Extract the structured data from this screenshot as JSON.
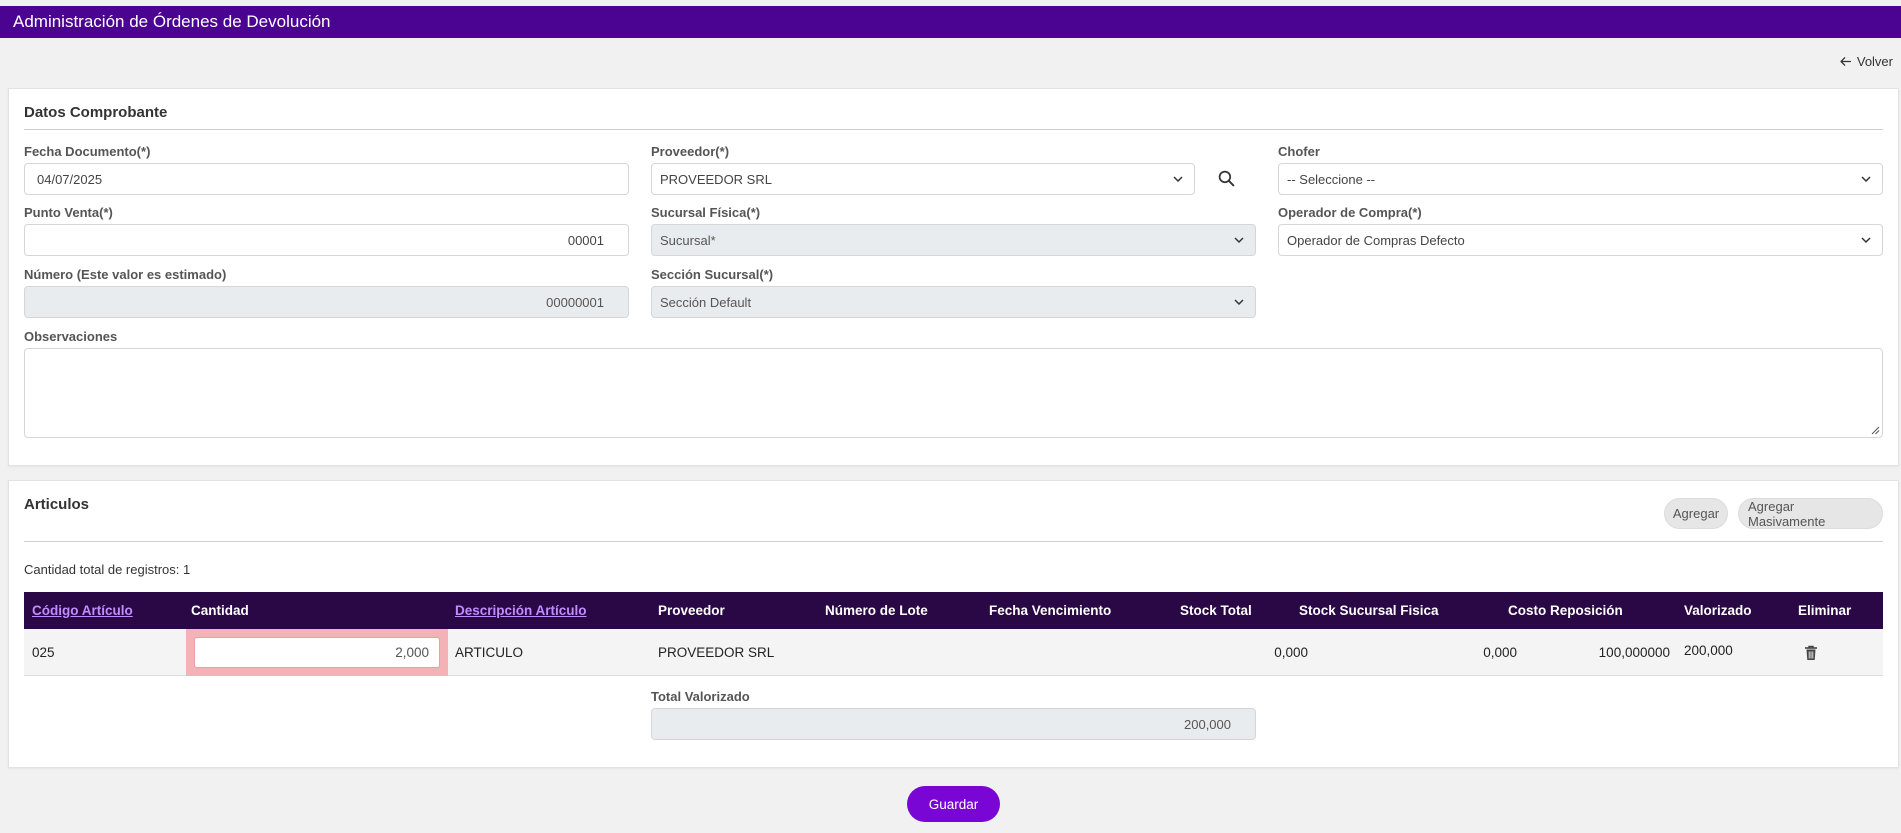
{
  "app": {
    "title": "Administración de Órdenes de Devolución",
    "back_label": "Volver"
  },
  "voucher": {
    "section_title": "Datos Comprobante",
    "fecha": {
      "label": "Fecha Documento(*)",
      "value": "04/07/2025"
    },
    "proveedor": {
      "label": "Proveedor(*)",
      "value": "PROVEEDOR SRL"
    },
    "chofer": {
      "label": "Chofer",
      "value": "-- Seleccione --"
    },
    "punto_venta": {
      "label": "Punto Venta(*)",
      "value": "00001"
    },
    "sucursal": {
      "label": "Sucursal Física(*)",
      "value": "Sucursal*"
    },
    "operador": {
      "label": "Operador de Compra(*)",
      "value": "Operador de Compras Defecto"
    },
    "numero": {
      "label": "Número (Este valor es estimado)",
      "value": "00000001"
    },
    "seccion": {
      "label": "Sección Sucursal(*)",
      "value": "Sección Default"
    },
    "observaciones": {
      "label": "Observaciones",
      "value": ""
    }
  },
  "articles": {
    "section_title": "Articulos",
    "add_label": "Agregar",
    "add_bulk_label": "Agregar Masivamente",
    "count_text": "Cantidad total de registros: 1",
    "columns": [
      "Código Artículo",
      "Cantidad",
      "Descripción Artículo",
      "Proveedor",
      "Número de Lote",
      "Fecha Vencimiento",
      "Stock Total",
      "Stock Sucursal Fisica",
      "Costo Reposición",
      "Valorizado",
      "Eliminar"
    ],
    "rows": [
      {
        "codigo": "025",
        "cantidad": "2,000",
        "descripcion": "ARTICULO",
        "proveedor": "PROVEEDOR SRL",
        "lote": "",
        "vencimiento": "",
        "stock_total": "0,000",
        "stock_sucursal": "0,000",
        "costo": "100,000000",
        "valorizado": "200,000"
      }
    ],
    "total_label": "Total Valorizado",
    "total_value": "200,000"
  },
  "save_label": "Guardar",
  "colors": {
    "header": "#4b0392",
    "table_header": "#2a0845",
    "accent": "#7a06d6",
    "link": "#c08cff",
    "invalid": "#f2b2b6"
  }
}
